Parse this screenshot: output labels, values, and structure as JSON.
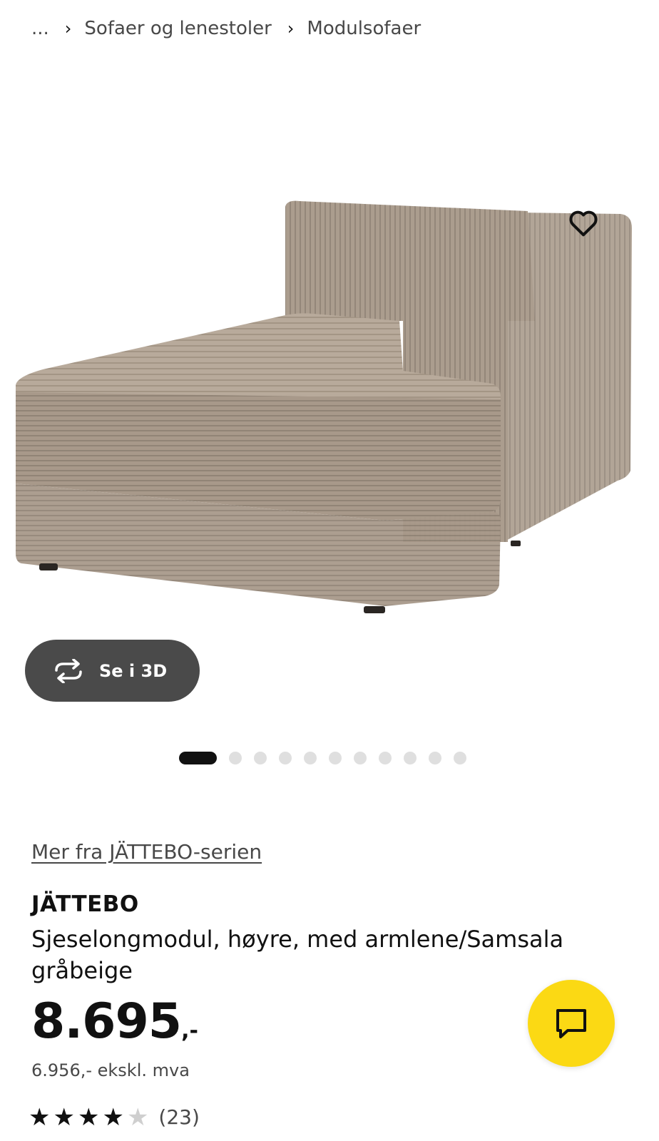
{
  "breadcrumb": {
    "ellipsis": "...",
    "items": [
      "Sofaer og lenestoler",
      "Modulsofaer"
    ]
  },
  "gallery": {
    "image_alt": "JÄTTEBO sjeselongmodul",
    "view_3d_label": "Se i 3D",
    "total_images": 11,
    "active_index": 0,
    "icons": {
      "favourite": "heart-icon",
      "view_3d": "rotate-icon"
    }
  },
  "product": {
    "series_link": "Mer fra JÄTTEBO-serien",
    "name": "JÄTTEBO",
    "description": "Sjeselongmodul, høyre, med armlene/Samsala gråbeige",
    "price_main": "8.695",
    "price_suffix": ",-",
    "price_ex_vat": "6.956,- ekskl. mva",
    "rating_stars": 4,
    "rating_max": 5,
    "review_count": "(23)"
  },
  "chat": {
    "icon": "chat-icon"
  },
  "colors": {
    "accent_yellow": "#fbd914",
    "button_dark": "#4a4a4a",
    "fabric": "#a89b8c"
  }
}
